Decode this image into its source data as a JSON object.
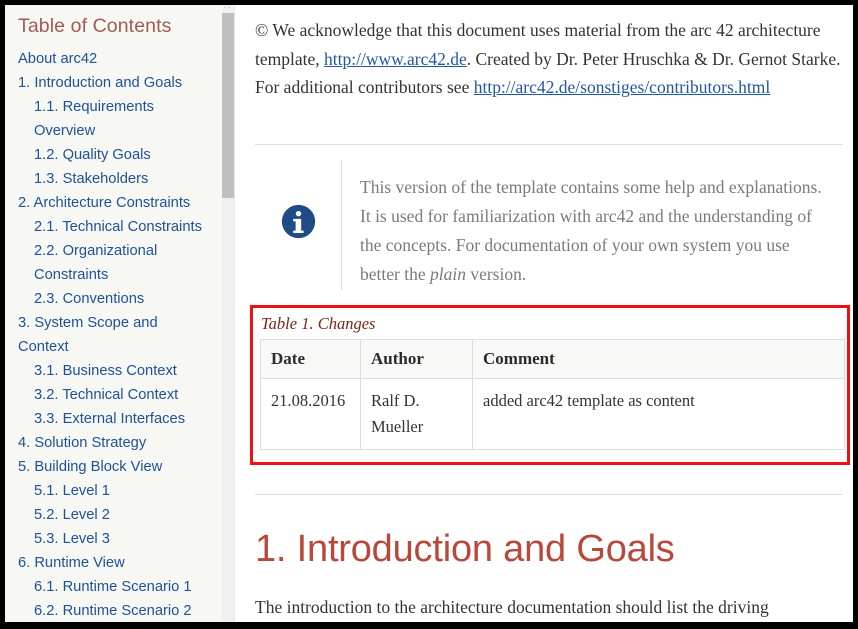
{
  "sidebar": {
    "title": "Table of Contents",
    "items": [
      {
        "label": "About arc42",
        "level": 1
      },
      {
        "label": "1. Introduction and Goals",
        "level": 1
      },
      {
        "label": "1.1. Requirements Overview",
        "level": 2
      },
      {
        "label": "1.2. Quality Goals",
        "level": 2
      },
      {
        "label": "1.3. Stakeholders",
        "level": 2
      },
      {
        "label": "2. Architecture Constraints",
        "level": 1
      },
      {
        "label": "2.1. Technical Constraints",
        "level": 2
      },
      {
        "label": "2.2. Organizational Constraints",
        "level": 2
      },
      {
        "label": "2.3. Conventions",
        "level": 2
      },
      {
        "label": "3. System Scope and Context",
        "level": 1
      },
      {
        "label": "3.1. Business Context",
        "level": 2
      },
      {
        "label": "3.2. Technical Context",
        "level": 2
      },
      {
        "label": "3.3. External Interfaces",
        "level": 2
      },
      {
        "label": "4. Solution Strategy",
        "level": 1
      },
      {
        "label": "5. Building Block View",
        "level": 1
      },
      {
        "label": "5.1. Level 1",
        "level": 2
      },
      {
        "label": "5.2. Level 2",
        "level": 2
      },
      {
        "label": "5.3. Level 3",
        "level": 2
      },
      {
        "label": "6. Runtime View",
        "level": 1
      },
      {
        "label": "6.1. Runtime Scenario 1",
        "level": 2
      },
      {
        "label": "6.2. Runtime Scenario 2",
        "level": 2
      }
    ]
  },
  "content": {
    "copyright": {
      "part1": "© We acknowledge that this document uses material from the arc 42 architecture template, ",
      "link1": "http://www.arc42.de",
      "part2": ". Created by Dr. Peter Hruschka & Dr. Gernot Starke. For additional contributors see ",
      "link2": "http://arc42.de/sonstiges/contributors.html"
    },
    "note": {
      "icon": "info-icon",
      "text_part1": "This version of the template contains some help and explanations. It is used for familiarization with arc42 and the understanding of the concepts. For documentation of your own system you use better the ",
      "text_emphasis": "plain",
      "text_part2": " version."
    },
    "table": {
      "caption": "Table 1. Changes",
      "headers": [
        "Date",
        "Author",
        "Comment"
      ],
      "rows": [
        [
          "21.08.2016",
          "Ralf D. Mueller",
          "added arc42 template as content"
        ]
      ]
    },
    "heading": "1. Introduction and Goals",
    "intro_paragraph": "The introduction to the architecture documentation should list the driving"
  },
  "scrollbar": {
    "cap_glyph": "··"
  },
  "colors": {
    "toc_title": "#a05c52",
    "link": "#1f5199",
    "heading": "#b9473b",
    "caption": "#7a2518",
    "highlight_border": "#ee1111",
    "note_icon": "#1f4b87",
    "sidebar_bg": "#f7f7f4"
  }
}
